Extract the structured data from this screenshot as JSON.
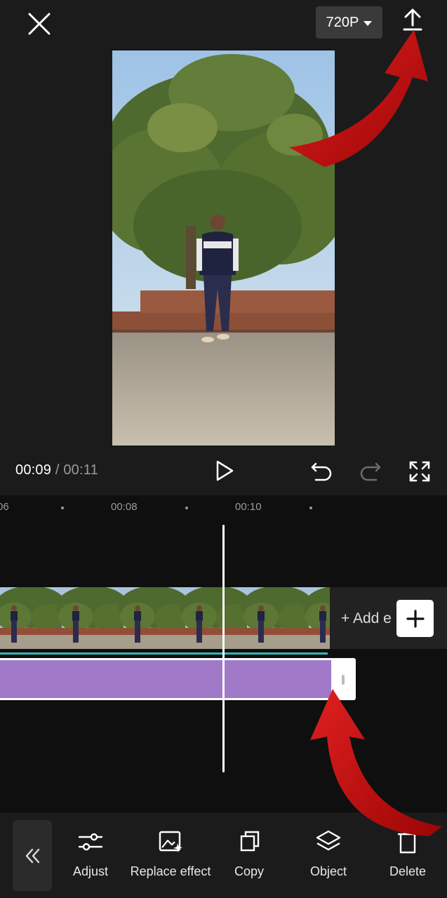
{
  "topbar": {
    "resolution": "720P",
    "icons": [
      "close-icon",
      "export-icon",
      "chevron-down-icon"
    ]
  },
  "player": {
    "current_time": "00:09",
    "separator": "/",
    "total_time": "00:11",
    "icons": [
      "play-icon",
      "undo-icon",
      "redo-icon",
      "fullscreen-icon"
    ]
  },
  "timeline": {
    "ticks": [
      "06",
      "00:08",
      "00:10"
    ],
    "add_ending_label": "+ Add e",
    "accent_color": "#2fb9bf",
    "effect_color": "#a07ac8"
  },
  "toolbar": {
    "items": [
      {
        "label": "Adjust",
        "icon": "sliders-icon"
      },
      {
        "label": "Replace effect",
        "icon": "replace-effect-icon"
      },
      {
        "label": "Copy",
        "icon": "copy-icon"
      },
      {
        "label": "Object",
        "icon": "layers-icon"
      },
      {
        "label": "Delete",
        "icon": "trash-icon"
      }
    ]
  },
  "annotation_color": "#c40a0a"
}
